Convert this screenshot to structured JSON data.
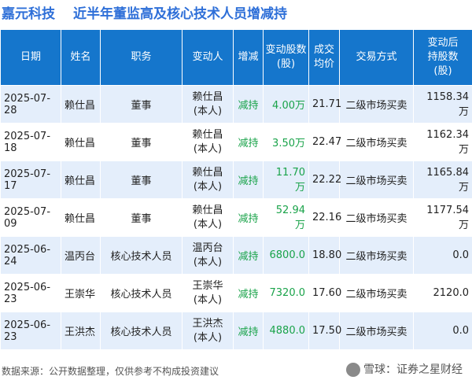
{
  "title": {
    "company": "嘉元科技",
    "text": "近半年董监高及核心技术人员增减持"
  },
  "table": {
    "headers": [
      "日期",
      "姓名",
      "职务",
      "变动人",
      "增减",
      "变动股数\n(股)",
      "成交\n均价",
      "交易方式",
      "变动后\n持股数\n(股)"
    ],
    "rows": [
      {
        "date": "2025-07-28",
        "name": "赖仕昌",
        "role": "董事",
        "changer": "赖仕昌\n(本人)",
        "action": "减持",
        "shares": "4.00万",
        "price": "21.71",
        "method": "二级市场买卖",
        "after": "1158.34万"
      },
      {
        "date": "2025-07-18",
        "name": "赖仕昌",
        "role": "董事",
        "changer": "赖仕昌\n(本人)",
        "action": "减持",
        "shares": "3.50万",
        "price": "22.47",
        "method": "二级市场买卖",
        "after": "1162.34万"
      },
      {
        "date": "2025-07-17",
        "name": "赖仕昌",
        "role": "董事",
        "changer": "赖仕昌\n(本人)",
        "action": "减持",
        "shares": "11.70万",
        "price": "22.22",
        "method": "二级市场买卖",
        "after": "1165.84万"
      },
      {
        "date": "2025-07-09",
        "name": "赖仕昌",
        "role": "董事",
        "changer": "赖仕昌\n(本人)",
        "action": "减持",
        "shares": "52.94万",
        "price": "22.16",
        "method": "二级市场买卖",
        "after": "1177.54万"
      },
      {
        "date": "2025-06-24",
        "name": "温丙台",
        "role": "核心技术人员",
        "changer": "温丙台\n(本人)",
        "action": "减持",
        "shares": "6800.0",
        "price": "18.80",
        "method": "二级市场买卖",
        "after": "0.0"
      },
      {
        "date": "2025-06-23",
        "name": "王崇华",
        "role": "核心技术人员",
        "changer": "王崇华\n(本人)",
        "action": "减持",
        "shares": "7320.0",
        "price": "17.60",
        "method": "二级市场买卖",
        "after": "2120.0"
      },
      {
        "date": "2025-06-23",
        "name": "王洪杰",
        "role": "核心技术人员",
        "changer": "王洪杰\n(本人)",
        "action": "减持",
        "shares": "4880.0",
        "price": "17.50",
        "method": "二级市场买卖",
        "after": "0.0"
      }
    ]
  },
  "footer": {
    "source": "数据来源：公开数据整理，仅供参考不构成投资建议"
  },
  "brand": {
    "text": "雪球：证券之星财经"
  },
  "watermark": {
    "text": "证券之星"
  },
  "colors": {
    "header_bg": "#1576cc",
    "row_alt": "#e4eefb",
    "title": "#2e6fd8",
    "decrease": "#1aa34a"
  }
}
